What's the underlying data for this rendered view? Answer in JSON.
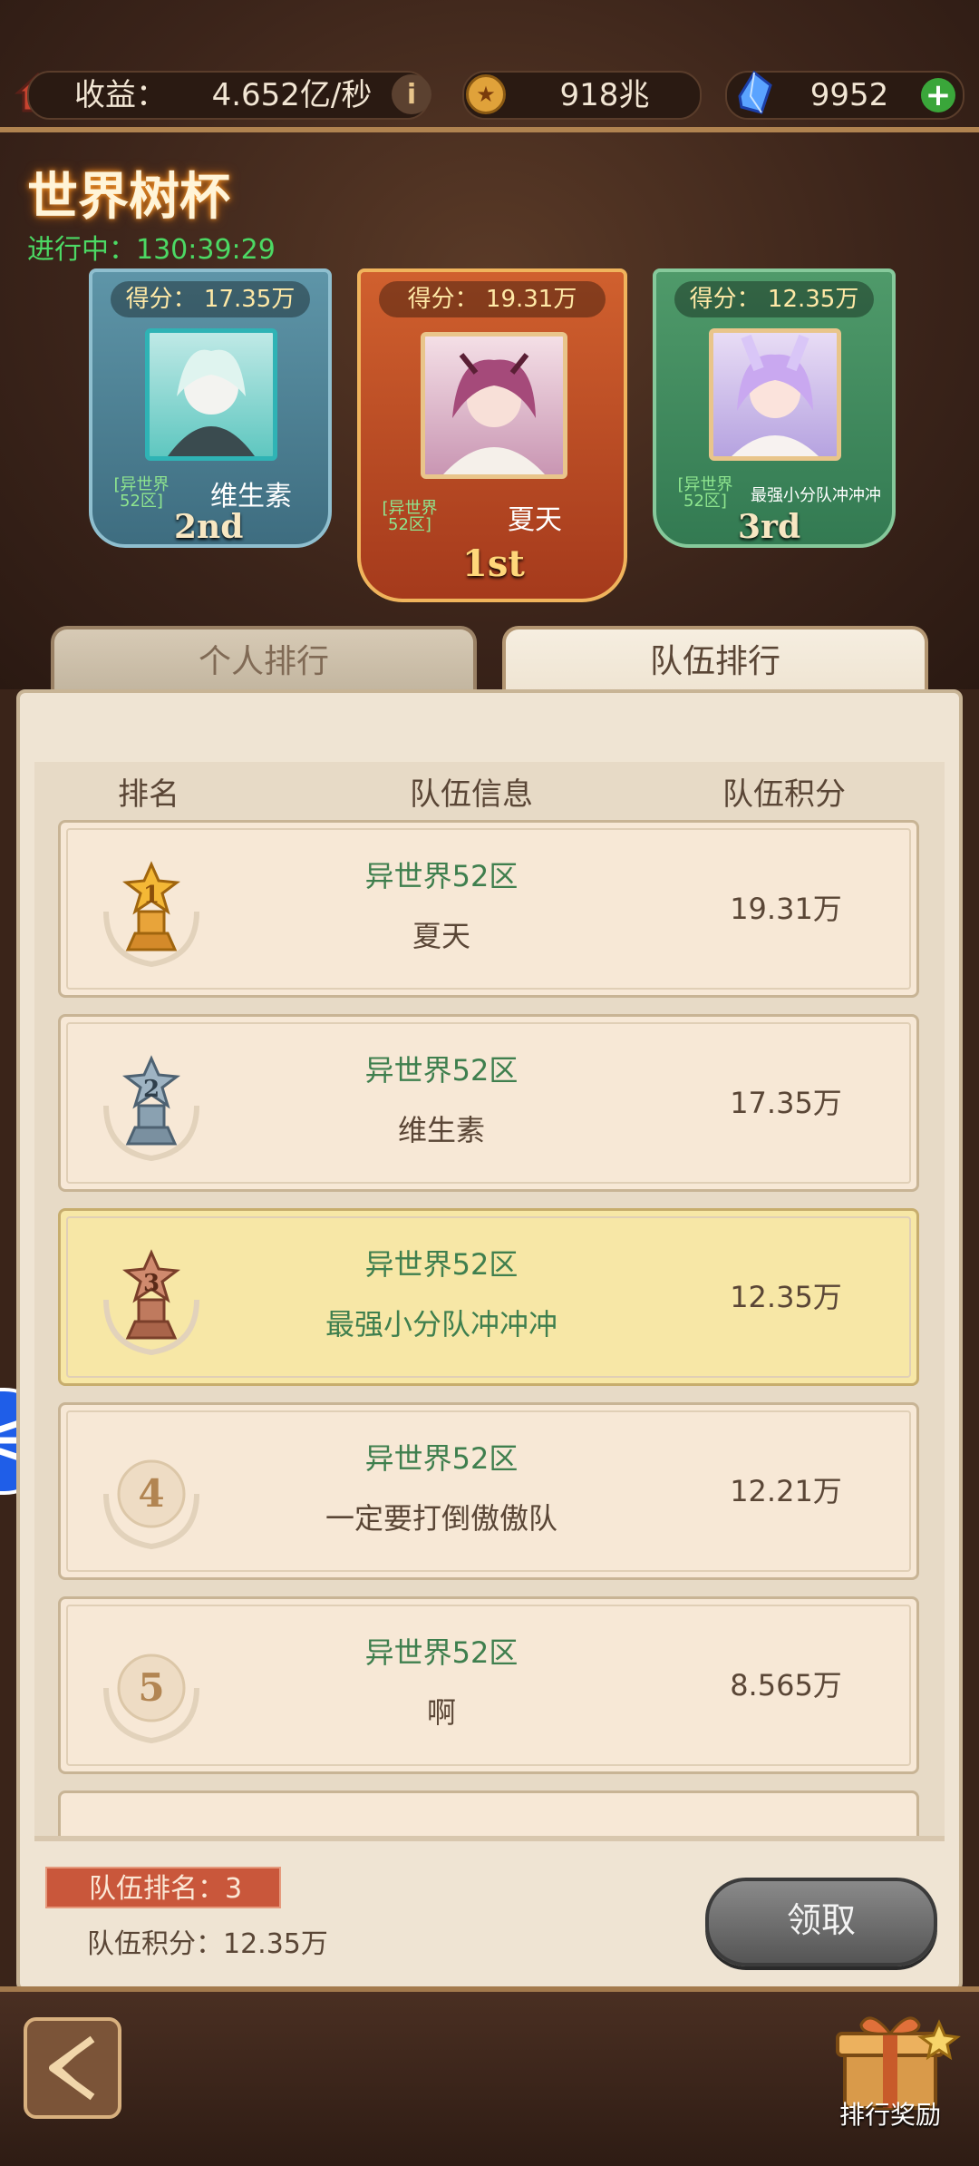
{
  "resources": {
    "income_label": "收益：",
    "income_value": "4.652亿/秒",
    "coins_value": "918兆",
    "gems_value": "9952"
  },
  "event": {
    "title": "世界树杯",
    "status": "进行中：130:39:29"
  },
  "podium": {
    "first": {
      "score": "得分： 19.31万",
      "server": "[异世界52区]",
      "name": "夏天",
      "rank": "1st"
    },
    "second": {
      "score": "得分： 17.35万",
      "server": "[异世界52区]",
      "name": "维生素",
      "rank": "2nd"
    },
    "third": {
      "score": "得分： 12.35万",
      "server": "[异世界52区]",
      "name": "最强小分队冲冲冲",
      "rank": "3rd"
    }
  },
  "tabs": {
    "personal": "个人排行",
    "team": "队伍排行"
  },
  "table": {
    "headers": {
      "rank": "排名",
      "info": "队伍信息",
      "points": "队伍积分"
    },
    "rows": [
      {
        "rank": "1",
        "server": "异世界52区",
        "name": "夏天",
        "points": "19.31万"
      },
      {
        "rank": "2",
        "server": "异世界52区",
        "name": "维生素",
        "points": "17.35万"
      },
      {
        "rank": "3",
        "server": "异世界52区",
        "name": "最强小分队冲冲冲",
        "points": "12.35万"
      },
      {
        "rank": "4",
        "server": "异世界52区",
        "name": "一定要打倒傲傲队",
        "points": "12.21万"
      },
      {
        "rank": "5",
        "server": "异世界52区",
        "name": "啊",
        "points": "8.565万"
      }
    ]
  },
  "footer": {
    "my_rank": "队伍排名：3",
    "my_score": "队伍积分：12.35万",
    "claim_label": "领取",
    "reward_label": "排行奖励"
  },
  "colors": {
    "accent_green": "#3f7f4e",
    "gold": "#b08350",
    "highlight_row": "#f7e7a6"
  }
}
